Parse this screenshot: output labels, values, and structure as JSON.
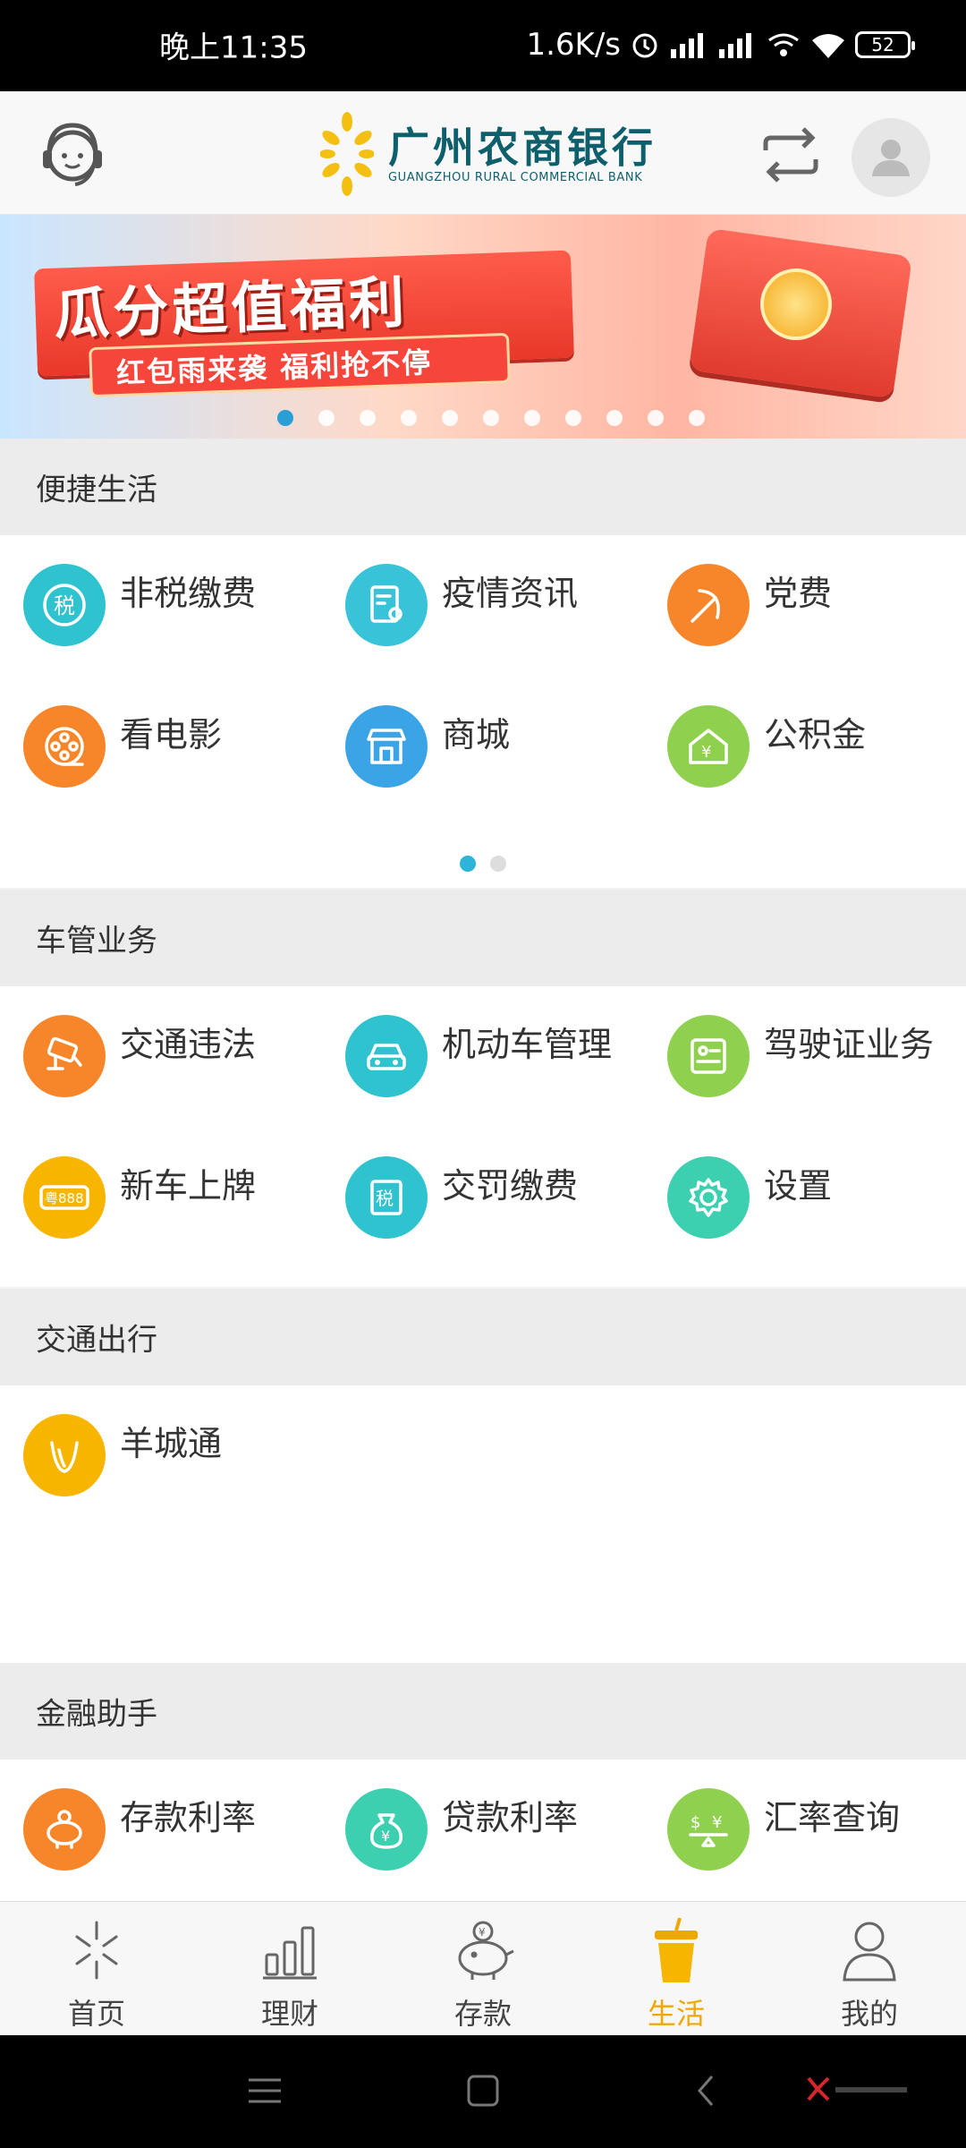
{
  "status_bar": {
    "time": "晚上11:35",
    "speed": "1.6K/s",
    "battery": "52"
  },
  "header": {
    "bank_name_cn": "广州农商银行",
    "bank_name_en": "GUANGZHOU RURAL COMMERCIAL BANK"
  },
  "banner": {
    "headline": "瓜分超值福利",
    "subline": "红包雨来袭 福利抢不停",
    "dot_count": 11,
    "active_dot": 0
  },
  "sections": [
    {
      "title": "便捷生活",
      "items": [
        {
          "label": "非税缴费",
          "icon": "tax-icon",
          "color": "#2ec3cf"
        },
        {
          "label": "疫情资讯",
          "icon": "document-icon",
          "color": "#39c3d9"
        },
        {
          "label": "党费",
          "icon": "hammer-sickle-icon",
          "color": "#f7862a"
        },
        {
          "label": "看电影",
          "icon": "film-reel-icon",
          "color": "#f7862a"
        },
        {
          "label": "商城",
          "icon": "store-icon",
          "color": "#3aa4e6"
        },
        {
          "label": "公积金",
          "icon": "house-fund-icon",
          "color": "#8fd14f"
        }
      ]
    },
    {
      "title": "车管业务",
      "items": [
        {
          "label": "交通违法",
          "icon": "traffic-camera-icon",
          "color": "#f7862a"
        },
        {
          "label": "机动车管理",
          "icon": "car-icon",
          "color": "#2ec3cf"
        },
        {
          "label": "驾驶证业务",
          "icon": "license-icon",
          "color": "#8fd14f"
        },
        {
          "label": "新车上牌",
          "icon": "license-plate-icon",
          "color": "#f7b500"
        },
        {
          "label": "交罚缴费",
          "icon": "fine-payment-icon",
          "color": "#2ec3cf"
        },
        {
          "label": "设置",
          "icon": "gear-icon",
          "color": "#3ccfb0"
        }
      ]
    },
    {
      "title": "交通出行",
      "items": [
        {
          "label": "羊城通",
          "icon": "yangchengtong-icon",
          "color": "#f7b500"
        }
      ]
    },
    {
      "title": "金融助手",
      "items": [
        {
          "label": "存款利率",
          "icon": "piggy-bank-icon",
          "color": "#f7862a"
        },
        {
          "label": "贷款利率",
          "icon": "money-bag-icon",
          "color": "#3ccfb0"
        },
        {
          "label": "汇率查询",
          "icon": "exchange-rate-icon",
          "color": "#8fd14f"
        }
      ]
    }
  ],
  "tabbar": {
    "items": [
      {
        "label": "首页",
        "icon": "home-logo-icon"
      },
      {
        "label": "理财",
        "icon": "bar-chart-icon"
      },
      {
        "label": "存款",
        "icon": "piggy-bank-icon"
      },
      {
        "label": "生活",
        "icon": "drink-cup-icon"
      },
      {
        "label": "我的",
        "icon": "user-icon"
      }
    ],
    "active_index": 3,
    "active_color": "#f0a800"
  }
}
